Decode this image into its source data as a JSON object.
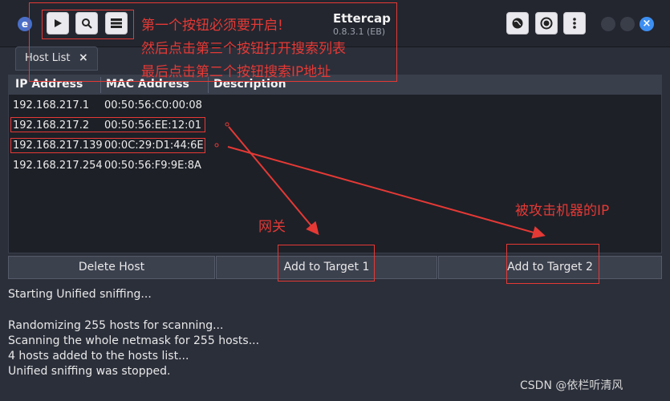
{
  "window": {
    "title": "Ettercap",
    "version": "0.8.3.1 (EB)"
  },
  "toolbar": {
    "start_icon": "play-icon",
    "scan_icon": "search-icon",
    "hostlist_icon": "server-list-icon"
  },
  "tab": {
    "label": "Host List",
    "close": "×"
  },
  "table": {
    "headers": [
      "IP Address",
      "MAC Address",
      "Description"
    ],
    "rows": [
      {
        "ip": "192.168.217.1",
        "mac": "00:50:56:C0:00:08",
        "desc": ""
      },
      {
        "ip": "192.168.217.2",
        "mac": "00:50:56:EE:12:01",
        "desc": ""
      },
      {
        "ip": "192.168.217.139",
        "mac": "00:0C:29:D1:44:6E",
        "desc": ""
      },
      {
        "ip": "192.168.217.254",
        "mac": "00:50:56:F9:9E:8A",
        "desc": ""
      }
    ]
  },
  "buttons": {
    "delete_host": "Delete Host",
    "add_target1": "Add to Target 1",
    "add_target2": "Add to Target 2"
  },
  "log": {
    "lines": [
      "Starting Unified sniffing...",
      "",
      "Randomizing 255 hosts for scanning...",
      "Scanning the whole netmask for 255 hosts...",
      "4 hosts added to the hosts list...",
      "Unified sniffing was stopped."
    ]
  },
  "annotations": {
    "instruction_1": "第一个按钮必须要开启!",
    "instruction_2": "然后点击第三个按钮打开搜索列表",
    "instruction_3": "最后点击第二个按钮搜索IP地址",
    "gateway": "网关",
    "victim": "被攻击机器的IP",
    "color": "#e53935"
  },
  "watermark": "CSDN @依栏听清风"
}
